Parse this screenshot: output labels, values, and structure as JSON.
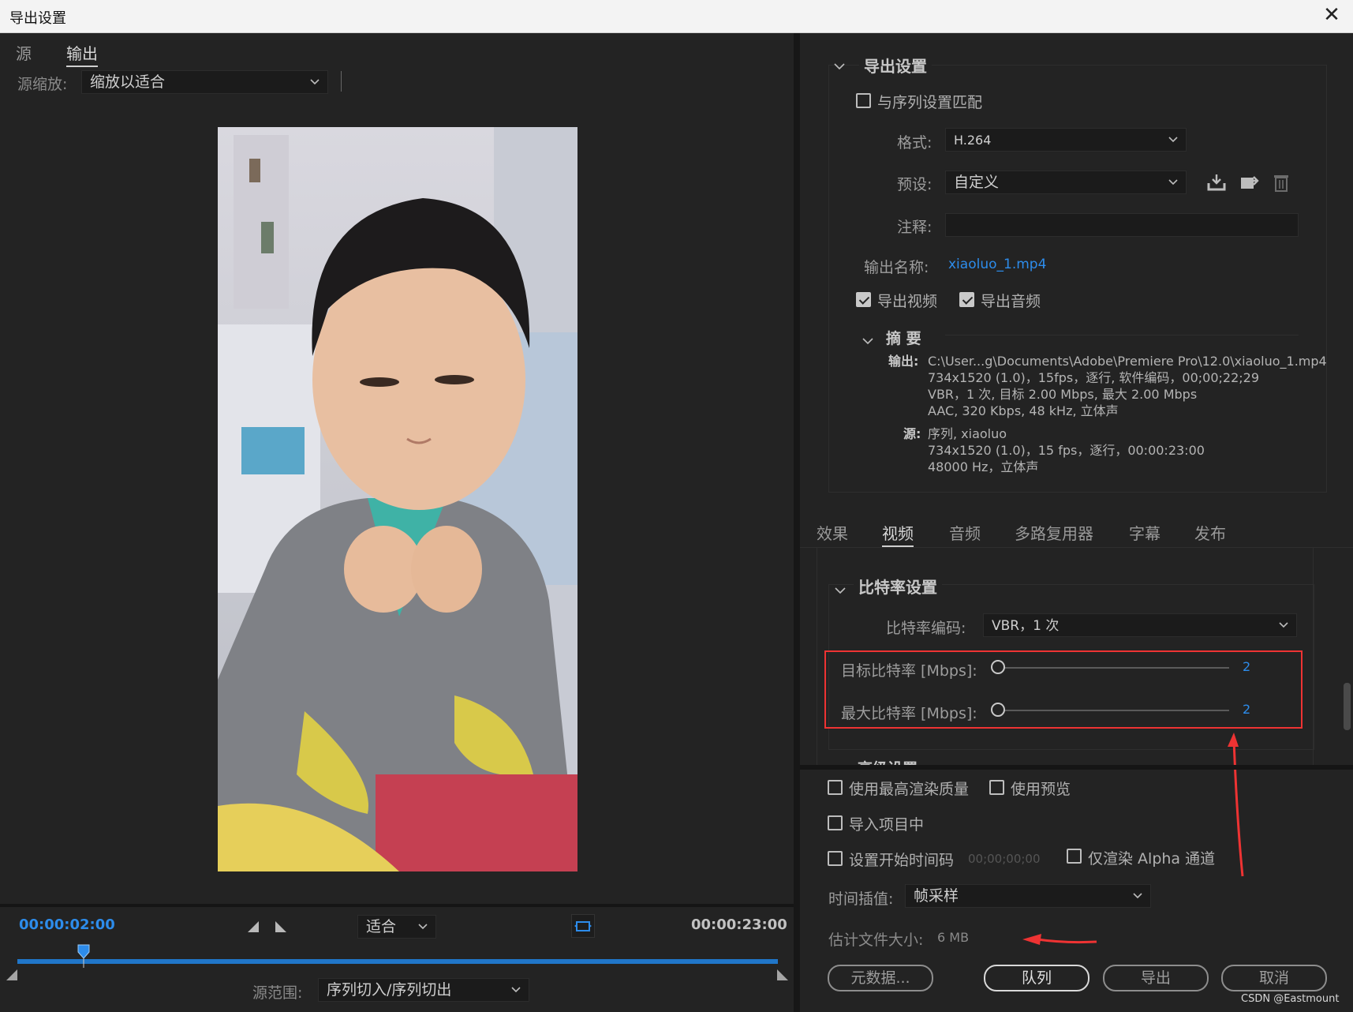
{
  "window": {
    "title": "导出设置"
  },
  "left": {
    "tabs": [
      "源",
      "输出"
    ],
    "active_tab": "输出",
    "source_scale_label": "源缩放:",
    "source_scale_value": "缩放以适合",
    "timeline": {
      "current_time": "00:00:02:00",
      "end_time": "00:00:23:00",
      "zoom_value": "适合",
      "playhead_fraction": 0.087,
      "source_range_label": "源范围:",
      "source_range_value": "序列切入/序列切出"
    }
  },
  "export_settings": {
    "section_title": "导出设置",
    "match_sequence_label": "与序列设置匹配",
    "match_sequence_checked": false,
    "format_label": "格式:",
    "format_value": "H.264",
    "preset_label": "预设:",
    "preset_value": "自定义",
    "comment_label": "注释:",
    "comment_value": "",
    "output_name_label": "输出名称:",
    "output_name_value": "xiaoluo_1.mp4",
    "export_video_label": "导出视频",
    "export_video_checked": true,
    "export_audio_label": "导出音频",
    "export_audio_checked": true,
    "summary_title": "摘 要",
    "summary_output_label": "输出:",
    "summary_output_lines": [
      "C:\\User...g\\Documents\\Adobe\\Premiere Pro\\12.0\\xiaoluo_1.mp4",
      "734x1520 (1.0)，15fps，逐行, 软件编码，00;00;22;29",
      "VBR，1 次, 目标 2.00 Mbps, 最大 2.00 Mbps",
      "AAC, 320 Kbps, 48  kHz, 立体声"
    ],
    "summary_source_label": "源:",
    "summary_source_lines": [
      "序列, xiaoluo",
      "734x1520 (1.0)，15 fps，逐行，00:00:23:00",
      "48000 Hz，立体声"
    ]
  },
  "settings_tabs": [
    "效果",
    "视频",
    "音频",
    "多路复用器",
    "字幕",
    "发布"
  ],
  "active_settings_tab": "视频",
  "bitrate": {
    "section_title": "比特率设置",
    "encoding_label": "比特率编码:",
    "encoding_value": "VBR，1 次",
    "target_label": "目标比特率 [Mbps]:",
    "target_value": "2",
    "target_fraction": 0.0,
    "max_label": "最大比特率 [Mbps]:",
    "max_value": "2",
    "max_fraction": 0.0,
    "next_section_partial": "高级设置"
  },
  "options": {
    "max_render_quality": "使用最高渲染质量",
    "use_previews": "使用预览",
    "import_into_project": "导入项目中",
    "set_start_timecode": "设置开始时间码",
    "start_timecode_value": "00;00;00;00",
    "render_alpha_only": "仅渲染 Alpha 通道",
    "time_interpolation_label": "时间插值:",
    "time_interpolation_value": "帧采样",
    "estimated_size_label": "估计文件大小:",
    "estimated_size_value": "6 MB"
  },
  "buttons": {
    "metadata": "元数据...",
    "queue": "队列",
    "export": "导出",
    "cancel": "取消"
  },
  "watermark": "CSDN @Eastmount",
  "colors": {
    "accent": "#2d8ceb",
    "annotation": "#e33333"
  }
}
